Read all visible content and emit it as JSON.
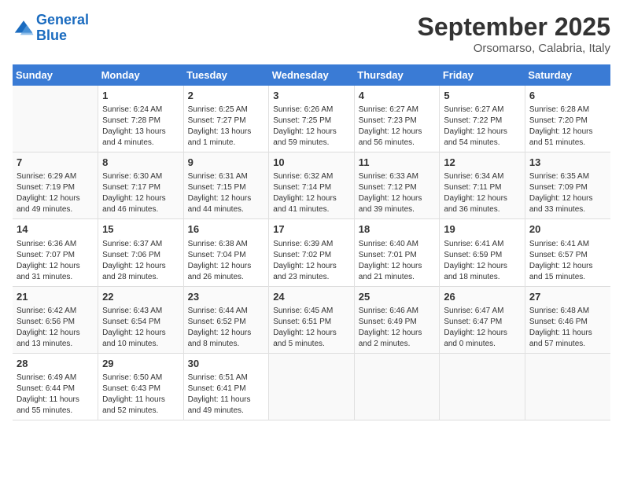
{
  "logo": {
    "line1": "General",
    "line2": "Blue"
  },
  "title": "September 2025",
  "location": "Orsomarso, Calabria, Italy",
  "weekdays": [
    "Sunday",
    "Monday",
    "Tuesday",
    "Wednesday",
    "Thursday",
    "Friday",
    "Saturday"
  ],
  "weeks": [
    [
      {
        "day": null,
        "info": null
      },
      {
        "day": "1",
        "info": "Sunrise: 6:24 AM\nSunset: 7:28 PM\nDaylight: 13 hours\nand 4 minutes."
      },
      {
        "day": "2",
        "info": "Sunrise: 6:25 AM\nSunset: 7:27 PM\nDaylight: 13 hours\nand 1 minute."
      },
      {
        "day": "3",
        "info": "Sunrise: 6:26 AM\nSunset: 7:25 PM\nDaylight: 12 hours\nand 59 minutes."
      },
      {
        "day": "4",
        "info": "Sunrise: 6:27 AM\nSunset: 7:23 PM\nDaylight: 12 hours\nand 56 minutes."
      },
      {
        "day": "5",
        "info": "Sunrise: 6:27 AM\nSunset: 7:22 PM\nDaylight: 12 hours\nand 54 minutes."
      },
      {
        "day": "6",
        "info": "Sunrise: 6:28 AM\nSunset: 7:20 PM\nDaylight: 12 hours\nand 51 minutes."
      }
    ],
    [
      {
        "day": "7",
        "info": "Sunrise: 6:29 AM\nSunset: 7:19 PM\nDaylight: 12 hours\nand 49 minutes."
      },
      {
        "day": "8",
        "info": "Sunrise: 6:30 AM\nSunset: 7:17 PM\nDaylight: 12 hours\nand 46 minutes."
      },
      {
        "day": "9",
        "info": "Sunrise: 6:31 AM\nSunset: 7:15 PM\nDaylight: 12 hours\nand 44 minutes."
      },
      {
        "day": "10",
        "info": "Sunrise: 6:32 AM\nSunset: 7:14 PM\nDaylight: 12 hours\nand 41 minutes."
      },
      {
        "day": "11",
        "info": "Sunrise: 6:33 AM\nSunset: 7:12 PM\nDaylight: 12 hours\nand 39 minutes."
      },
      {
        "day": "12",
        "info": "Sunrise: 6:34 AM\nSunset: 7:11 PM\nDaylight: 12 hours\nand 36 minutes."
      },
      {
        "day": "13",
        "info": "Sunrise: 6:35 AM\nSunset: 7:09 PM\nDaylight: 12 hours\nand 33 minutes."
      }
    ],
    [
      {
        "day": "14",
        "info": "Sunrise: 6:36 AM\nSunset: 7:07 PM\nDaylight: 12 hours\nand 31 minutes."
      },
      {
        "day": "15",
        "info": "Sunrise: 6:37 AM\nSunset: 7:06 PM\nDaylight: 12 hours\nand 28 minutes."
      },
      {
        "day": "16",
        "info": "Sunrise: 6:38 AM\nSunset: 7:04 PM\nDaylight: 12 hours\nand 26 minutes."
      },
      {
        "day": "17",
        "info": "Sunrise: 6:39 AM\nSunset: 7:02 PM\nDaylight: 12 hours\nand 23 minutes."
      },
      {
        "day": "18",
        "info": "Sunrise: 6:40 AM\nSunset: 7:01 PM\nDaylight: 12 hours\nand 21 minutes."
      },
      {
        "day": "19",
        "info": "Sunrise: 6:41 AM\nSunset: 6:59 PM\nDaylight: 12 hours\nand 18 minutes."
      },
      {
        "day": "20",
        "info": "Sunrise: 6:41 AM\nSunset: 6:57 PM\nDaylight: 12 hours\nand 15 minutes."
      }
    ],
    [
      {
        "day": "21",
        "info": "Sunrise: 6:42 AM\nSunset: 6:56 PM\nDaylight: 12 hours\nand 13 minutes."
      },
      {
        "day": "22",
        "info": "Sunrise: 6:43 AM\nSunset: 6:54 PM\nDaylight: 12 hours\nand 10 minutes."
      },
      {
        "day": "23",
        "info": "Sunrise: 6:44 AM\nSunset: 6:52 PM\nDaylight: 12 hours\nand 8 minutes."
      },
      {
        "day": "24",
        "info": "Sunrise: 6:45 AM\nSunset: 6:51 PM\nDaylight: 12 hours\nand 5 minutes."
      },
      {
        "day": "25",
        "info": "Sunrise: 6:46 AM\nSunset: 6:49 PM\nDaylight: 12 hours\nand 2 minutes."
      },
      {
        "day": "26",
        "info": "Sunrise: 6:47 AM\nSunset: 6:47 PM\nDaylight: 12 hours\nand 0 minutes."
      },
      {
        "day": "27",
        "info": "Sunrise: 6:48 AM\nSunset: 6:46 PM\nDaylight: 11 hours\nand 57 minutes."
      }
    ],
    [
      {
        "day": "28",
        "info": "Sunrise: 6:49 AM\nSunset: 6:44 PM\nDaylight: 11 hours\nand 55 minutes."
      },
      {
        "day": "29",
        "info": "Sunrise: 6:50 AM\nSunset: 6:43 PM\nDaylight: 11 hours\nand 52 minutes."
      },
      {
        "day": "30",
        "info": "Sunrise: 6:51 AM\nSunset: 6:41 PM\nDaylight: 11 hours\nand 49 minutes."
      },
      {
        "day": null,
        "info": null
      },
      {
        "day": null,
        "info": null
      },
      {
        "day": null,
        "info": null
      },
      {
        "day": null,
        "info": null
      }
    ]
  ]
}
